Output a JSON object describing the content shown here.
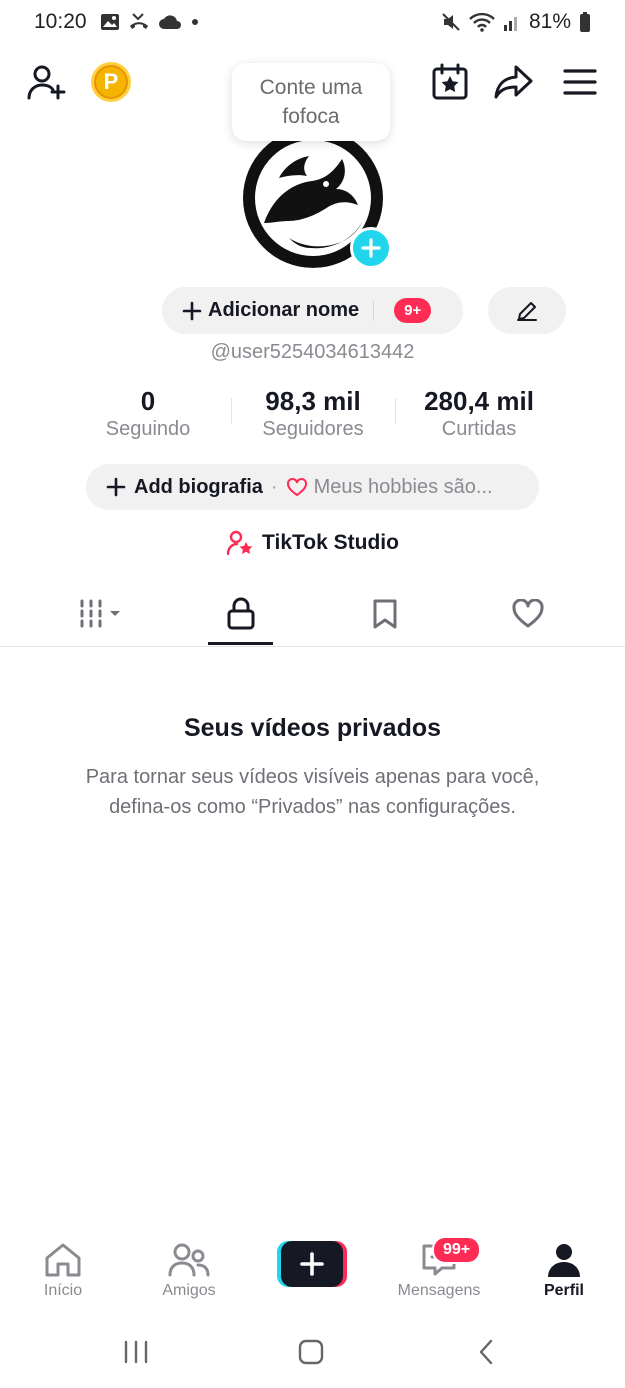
{
  "status_bar": {
    "time": "10:20",
    "battery": "81%"
  },
  "top_bar": {
    "coin_letter": "P",
    "tooltip": "Conte uma fofoca"
  },
  "profile": {
    "add_name_label": "Adicionar nome",
    "add_name_badge": "9+",
    "username": "@user5254034613442",
    "stats": [
      {
        "value": "0",
        "label": "Seguindo"
      },
      {
        "value": "98,3 mil",
        "label": "Seguidores"
      },
      {
        "value": "280,4 mil",
        "label": "Curtidas"
      }
    ],
    "bio_button_label": "Add biografia",
    "bio_separator": "·",
    "bio_hint": "Meus hobbies são...",
    "studio_label": "TikTok Studio"
  },
  "tabs": {
    "icons": [
      "grid-icon",
      "lock-icon",
      "bookmark-icon",
      "heart-icon"
    ],
    "active_index": 1
  },
  "empty_state": {
    "title": "Seus vídeos privados",
    "text": "Para tornar seus vídeos visíveis apenas para você, defina-os como “Privados” nas configurações."
  },
  "bottom_nav": {
    "items": [
      {
        "label": "Início"
      },
      {
        "label": "Amigos"
      },
      {
        "label": "Mensagens",
        "badge": "99+"
      },
      {
        "label": "Perfil"
      }
    ]
  },
  "colors": {
    "accent_red": "#fe2c55",
    "accent_cyan": "#20d5ec",
    "text_primary": "#161823",
    "text_secondary": "#8a8b91"
  }
}
